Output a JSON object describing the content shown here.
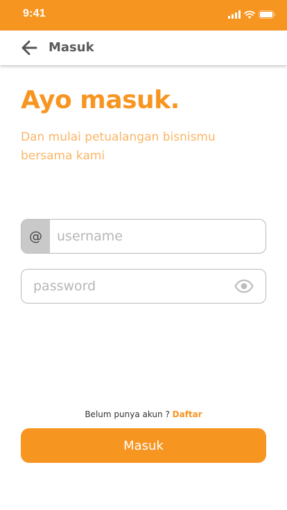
{
  "colors": {
    "brand": "#F79521",
    "subtitle": "#FAB565",
    "field_border": "#b9b9b9",
    "prefix_bg": "#c9c9c9"
  },
  "status_bar": {
    "time": "9:41",
    "icons": [
      "signal-icon",
      "wifi-icon",
      "battery-icon"
    ]
  },
  "app_bar": {
    "back_icon": "arrow-left-icon",
    "title": "Masuk"
  },
  "headline": "Ayo masuk.",
  "subtitle": "Dan mulai petualangan bisnismu bersama kami",
  "username": {
    "prefix": "@",
    "placeholder": "username",
    "value": ""
  },
  "password": {
    "placeholder": "password",
    "value": "",
    "toggle_icon": "eye-icon"
  },
  "signup": {
    "prompt": "Belum punya akun ?",
    "link": "Daftar"
  },
  "login_button": "Masuk"
}
